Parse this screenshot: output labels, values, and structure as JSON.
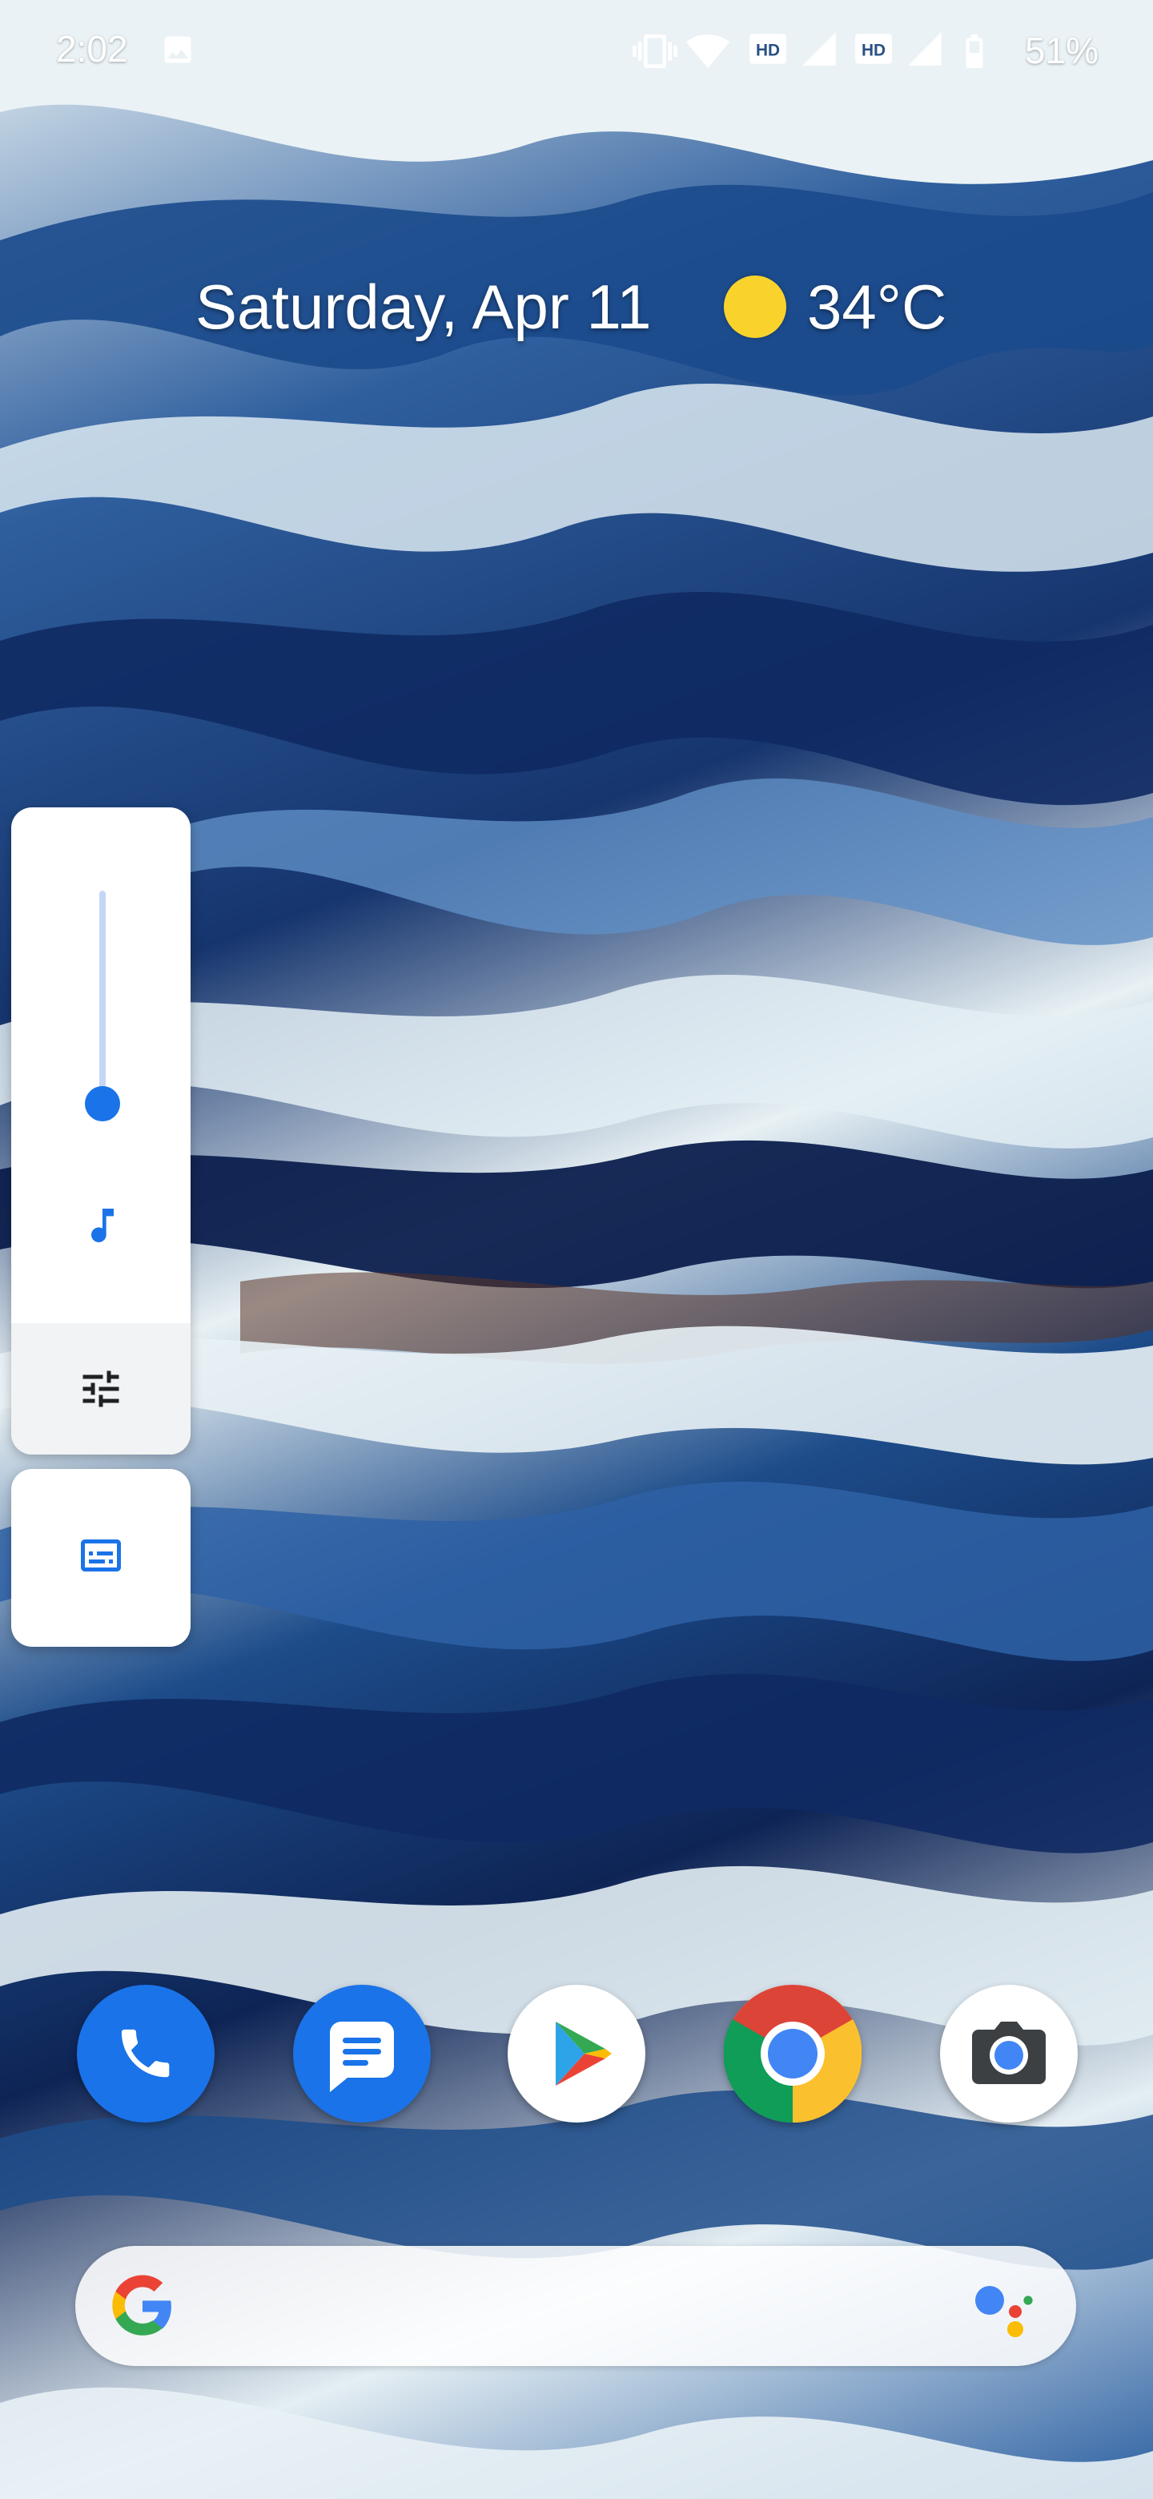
{
  "status_bar": {
    "time": "2:02",
    "battery": "51%",
    "icons": [
      "image-notification-icon",
      "vibrate-icon",
      "wifi-icon",
      "hd-icon",
      "signal-icon",
      "hd-icon",
      "signal-icon",
      "battery-icon"
    ]
  },
  "glance": {
    "date": "Saturday, Apr 11",
    "weather_icon": "sun-icon",
    "temperature": "34°C"
  },
  "volume_panel": {
    "level": 0.05,
    "stream_icon": "music-note-icon",
    "settings_icon": "equalizer-settings-icon",
    "captions_icon": "live-caption-icon",
    "accent_color": "#1a73e8",
    "track_color": "#c5d6f5"
  },
  "dock": {
    "apps": [
      {
        "name": "Phone",
        "icon": "phone-icon"
      },
      {
        "name": "Messages",
        "icon": "messages-icon"
      },
      {
        "name": "Play Store",
        "icon": "play-store-icon"
      },
      {
        "name": "Chrome",
        "icon": "chrome-icon"
      },
      {
        "name": "Camera",
        "icon": "camera-icon"
      }
    ]
  },
  "search_bar": {
    "logo": "google-g-icon",
    "assistant": "google-assistant-icon"
  }
}
